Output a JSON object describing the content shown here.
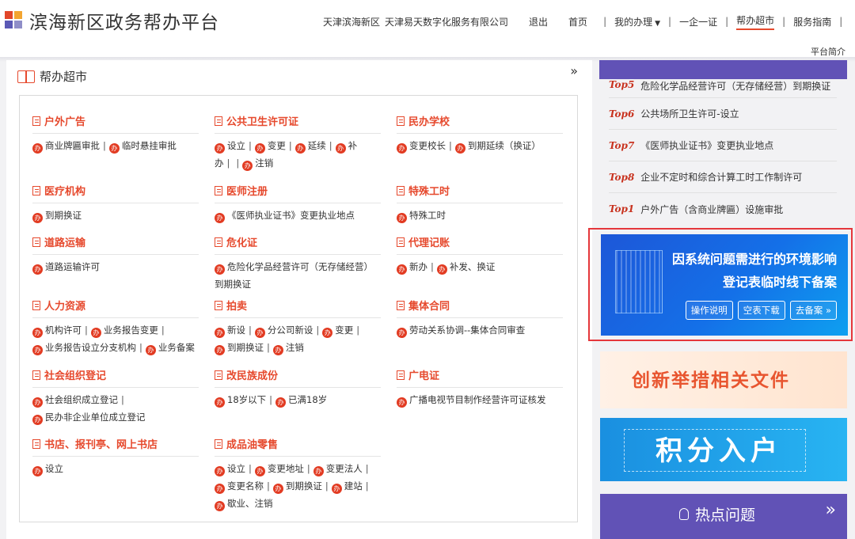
{
  "header": {
    "site_title": "滨海新区政务帮办平台",
    "user": {
      "district": "天津滨海新区",
      "company": "天津易天数字化服务有限公司"
    },
    "logout": "退出",
    "nav": [
      "首页",
      "我的办理",
      "一企一证",
      "帮办超市",
      "服务指南"
    ],
    "active_nav": "帮办超市",
    "intro": "平台简介"
  },
  "main": {
    "title": "帮办超市",
    "more": "»",
    "badge": "办",
    "categories": [
      {
        "name": "户外广告",
        "lines": [
          [
            "商业牌匾审批",
            "临时悬挂审批"
          ]
        ]
      },
      {
        "name": "公共卫生许可证",
        "lines": [
          [
            "设立",
            "变更",
            "延续",
            "补"
          ],
          [
            "办",
            "注销"
          ]
        ]
      },
      {
        "name": "民办学校",
        "lines": [
          [
            "变更校长",
            "到期延续（换证）"
          ]
        ]
      },
      {
        "name": "医疗机构",
        "lines": [
          [
            "到期换证"
          ]
        ]
      },
      {
        "name": "医师注册",
        "lines": [
          [
            "《医师执业证书》变更执业地点"
          ]
        ]
      },
      {
        "name": "特殊工时",
        "lines": [
          [
            "特殊工时"
          ]
        ]
      },
      {
        "name": "道路运输",
        "lines": [
          [
            "道路运输许可"
          ]
        ]
      },
      {
        "name": "危化证",
        "lines": [
          [
            "危险化学品经营许可（无存储经营）"
          ],
          [
            "到期换证"
          ]
        ]
      },
      {
        "name": "代理记账",
        "lines": [
          [
            "新办",
            "补发、换证"
          ]
        ]
      },
      {
        "name": "人力资源",
        "lines": [
          [
            "机构许可",
            "业务报告变更"
          ],
          [
            "业务报告设立分支机构",
            "业务备案"
          ]
        ]
      },
      {
        "name": "拍卖",
        "lines": [
          [
            "新设",
            "分公司新设",
            "变更"
          ],
          [
            "到期换证",
            "注销"
          ]
        ]
      },
      {
        "name": "集体合同",
        "lines": [
          [
            "劳动关系协调--集体合同审查"
          ]
        ]
      },
      {
        "name": "社会组织登记",
        "lines": [
          [
            "社会组织成立登记"
          ],
          [
            "民办非企业单位成立登记"
          ]
        ]
      },
      {
        "name": "改民族成份",
        "lines": [
          [
            "18岁以下",
            "已满18岁"
          ]
        ]
      },
      {
        "name": "广电证",
        "lines": [
          [
            "广播电视节目制作经营许可证核发"
          ]
        ]
      },
      {
        "name": "书店、报刊亭、网上书店",
        "lines": [
          [
            "设立"
          ]
        ]
      },
      {
        "name": "成品油零售",
        "lines": [
          [
            "设立",
            "变更地址",
            "变更法人"
          ],
          [
            "变更名称",
            "到期换证",
            "建站"
          ],
          [
            "歇业、注销"
          ]
        ]
      }
    ]
  },
  "sidebar": {
    "ranking": [
      {
        "no": "Top5",
        "text": "危险化学品经营许可（无存储经营）到期换证"
      },
      {
        "no": "Top6",
        "text": "公共场所卫生许可-设立"
      },
      {
        "no": "Top7",
        "text": "《医师执业证书》变更执业地点"
      },
      {
        "no": "Top8",
        "text": "企业不定时和综合计算工时工作制许可"
      },
      {
        "no": "Top1",
        "text": "户外广告（含商业牌匾）设施审批"
      }
    ],
    "notice": {
      "line1": "因系统问题需进行的环境影响",
      "line2": "登记表临时线下备案",
      "buttons": [
        "操作说明",
        "空表下载",
        "去备案 »"
      ]
    },
    "banner_innovation": "创新举措相关文件",
    "banner_points": "积分入户",
    "hot": {
      "title": "热点问题",
      "more": "»"
    }
  },
  "colors": {
    "accent": "#e6492d",
    "purple": "#6152b6",
    "badge": "#e23b22"
  }
}
